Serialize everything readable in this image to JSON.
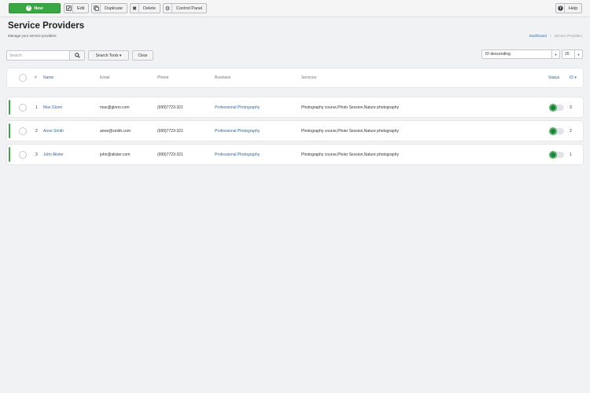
{
  "toolbar": {
    "new_label": "New",
    "edit_label": "Edit",
    "duplicate_label": "Duplicate",
    "delete_label": "Delete",
    "control_panel_label": "Control Panel",
    "help_label": "Help"
  },
  "page": {
    "title": "Service Providers",
    "subtitle": "Manage your service providers"
  },
  "breadcrumb": {
    "home": "Dashboard",
    "separator": "/",
    "current": "Service Providers"
  },
  "filters": {
    "search_placeholder": "Search",
    "search_tools_label": "Search Tools ▾",
    "clear_label": "Clear",
    "sort_value": "ID descending",
    "limit_value": "20"
  },
  "table": {
    "columns": {
      "num": "#",
      "name": "Name",
      "email": "Email",
      "phone": "Phone",
      "business": "Business",
      "services": "Services",
      "status": "Status",
      "id": "ID ▾"
    },
    "rows": [
      {
        "num": "1",
        "name": "Max Glonn",
        "email": "max@glonn.com",
        "phone": "(999)7723-321",
        "business": "Professional Photography",
        "services": "Photography course,Photo Session,Nature photography",
        "status": "published",
        "id": "3"
      },
      {
        "num": "2",
        "name": "Anne Smith",
        "email": "anne@smith.com",
        "phone": "(999)7723-321",
        "business": "Professional Photography",
        "services": "Photography course,Photo Session,Nature photography",
        "status": "published",
        "id": "2"
      },
      {
        "num": "3",
        "name": "John Alister",
        "email": "john@alister.com",
        "phone": "(999)7723-321",
        "business": "Professional Photography",
        "services": "Photography course,Photo Session,Nature photography",
        "status": "published",
        "id": "1"
      }
    ]
  },
  "colors": {
    "primary_green": "#3aa744",
    "link_blue": "#2f6aa8",
    "toggle_on": "#1c7f3c"
  }
}
